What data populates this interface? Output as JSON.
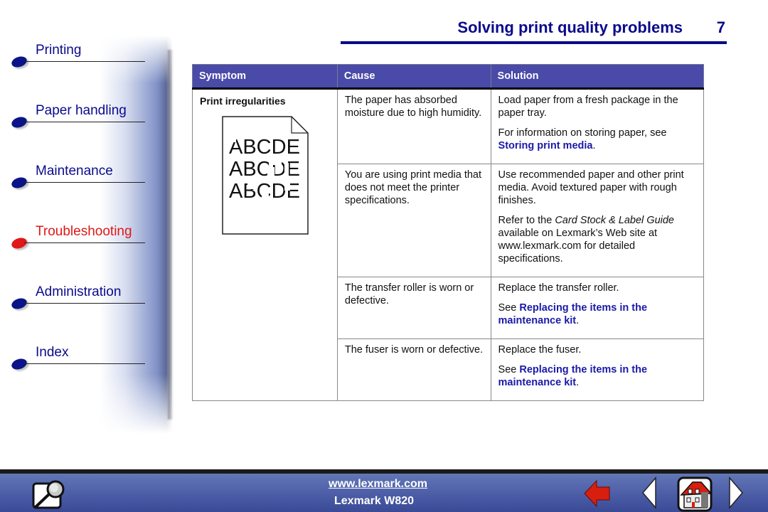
{
  "header": {
    "title": "Solving print quality problems",
    "page_number": "7"
  },
  "sidebar": {
    "items": [
      {
        "label": "Printing",
        "active": false
      },
      {
        "label": "Paper handling",
        "active": false
      },
      {
        "label": "Maintenance",
        "active": false
      },
      {
        "label": "Troubleshooting",
        "active": true
      },
      {
        "label": "Administration",
        "active": false
      },
      {
        "label": "Index",
        "active": false
      }
    ]
  },
  "table": {
    "headers": [
      "Symptom",
      "Cause",
      "Solution"
    ],
    "symptom": {
      "title": "Print irregularities",
      "illustration_lines": [
        "ABCDE",
        "ABCDE",
        "ABCDE"
      ]
    },
    "rows": [
      {
        "cause": "The paper has absorbed moisture due to high humidity.",
        "solution": [
          {
            "text": "Load paper from a fresh package in the paper tray."
          },
          {
            "prefix": "For information on storing paper, see ",
            "link": "Storing print media",
            "suffix": "."
          }
        ]
      },
      {
        "cause": "You are using print media that does not meet the printer specifications.",
        "solution": [
          {
            "text": "Use recommended paper and other print media. Avoid textured paper with rough finishes."
          },
          {
            "prefix": "Refer to the ",
            "italic": "Card Stock & Label Guide",
            "suffix": " available on Lexmark’s Web site at www.lexmark.com for detailed specifications."
          }
        ]
      },
      {
        "cause": "The transfer roller is worn or defective.",
        "solution": [
          {
            "text": "Replace the transfer roller."
          },
          {
            "prefix": "See ",
            "link": "Replacing the items in the maintenance kit",
            "suffix": "."
          }
        ]
      },
      {
        "cause": "The fuser is worn or defective.",
        "solution": [
          {
            "text": "Replace the fuser."
          },
          {
            "prefix": "See ",
            "link": "Replacing the items in the maintenance kit",
            "suffix": "."
          }
        ]
      }
    ]
  },
  "footer": {
    "url": "www.lexmark.com",
    "model": "Lexmark W820",
    "buttons": {
      "search": "search-icon",
      "back": "back-arrow-icon",
      "prev": "previous-page-icon",
      "home": "home-icon",
      "next": "next-page-icon"
    }
  },
  "colors": {
    "brand_blue": "#0a0a8c",
    "active_red": "#e01818",
    "table_header": "#4a4aa8",
    "link_blue": "#1a1aa8",
    "footer_blue": "#4e5fa8"
  }
}
